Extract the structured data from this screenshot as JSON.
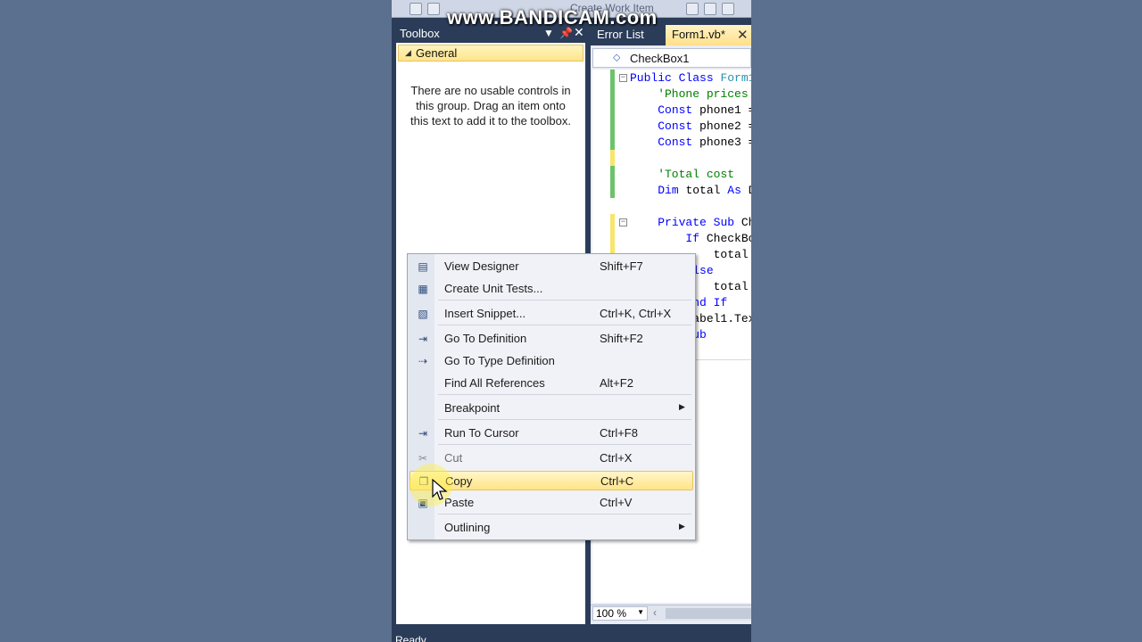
{
  "watermark": "www.BANDICAM.com",
  "toolbar": {
    "partial_text": "Create Work Item"
  },
  "toolbox": {
    "title": "Toolbox",
    "group": "General",
    "empty_message": "There are no usable controls in this group. Drag an item onto this text to add it to the toolbox."
  },
  "editor": {
    "tabs": [
      {
        "label": "Error List"
      },
      {
        "label": "Form1.vb*",
        "active": true
      }
    ],
    "member_dropdown": "CheckBox1",
    "code_lines": [
      {
        "text": "Public Class Form1"
      },
      {
        "text": "    'Phone prices"
      },
      {
        "text": "    Const phone1 ="
      },
      {
        "text": "    Const phone2 ="
      },
      {
        "text": "    Const phone3 ="
      },
      {
        "text": ""
      },
      {
        "text": "    'Total cost"
      },
      {
        "text": "    Dim total As D"
      },
      {
        "text": ""
      },
      {
        "text": "    Private Sub Ch"
      },
      {
        "text": "        If CheckBo"
      },
      {
        "text": "            total"
      },
      {
        "text": "        Else"
      },
      {
        "text": "            total"
      },
      {
        "text": "        End If"
      },
      {
        "text": "        Label1.Tex"
      },
      {
        "text": "    End Sub"
      }
    ],
    "zoom": "100 %"
  },
  "status_bar": {
    "text": "Ready"
  },
  "context_menu": {
    "items": [
      {
        "icon": "view-designer-icon",
        "label": "View Designer",
        "shortcut": "Shift+F7"
      },
      {
        "icon": "unit-tests-icon",
        "label": "Create Unit Tests...",
        "shortcut": ""
      },
      {
        "icon": "snippet-icon",
        "label": "Insert Snippet...",
        "shortcut": "Ctrl+K, Ctrl+X"
      },
      {
        "icon": "go-to-definition-icon",
        "label": "Go To Definition",
        "shortcut": "Shift+F2"
      },
      {
        "icon": "go-to-type-definition-icon",
        "label": "Go To Type Definition",
        "shortcut": ""
      },
      {
        "icon": "",
        "label": "Find All References",
        "shortcut": "Alt+F2"
      },
      {
        "icon": "",
        "label": "Breakpoint",
        "shortcut": "",
        "submenu": true
      },
      {
        "icon": "run-to-cursor-icon",
        "label": "Run To Cursor",
        "shortcut": "Ctrl+F8"
      },
      {
        "icon": "scissors-icon",
        "label": "Cut",
        "shortcut": "Ctrl+X",
        "disabled": true
      },
      {
        "icon": "copy-icon",
        "label": "Copy",
        "shortcut": "Ctrl+C",
        "highlighted": true
      },
      {
        "icon": "paste-icon",
        "label": "Paste",
        "shortcut": "Ctrl+V"
      },
      {
        "icon": "",
        "label": "Outlining",
        "shortcut": "",
        "submenu": true
      }
    ]
  },
  "colors": {
    "ide_background": "#2b3c59",
    "desktop_background": "#5b6f8e",
    "highlight": "#ffe487"
  }
}
